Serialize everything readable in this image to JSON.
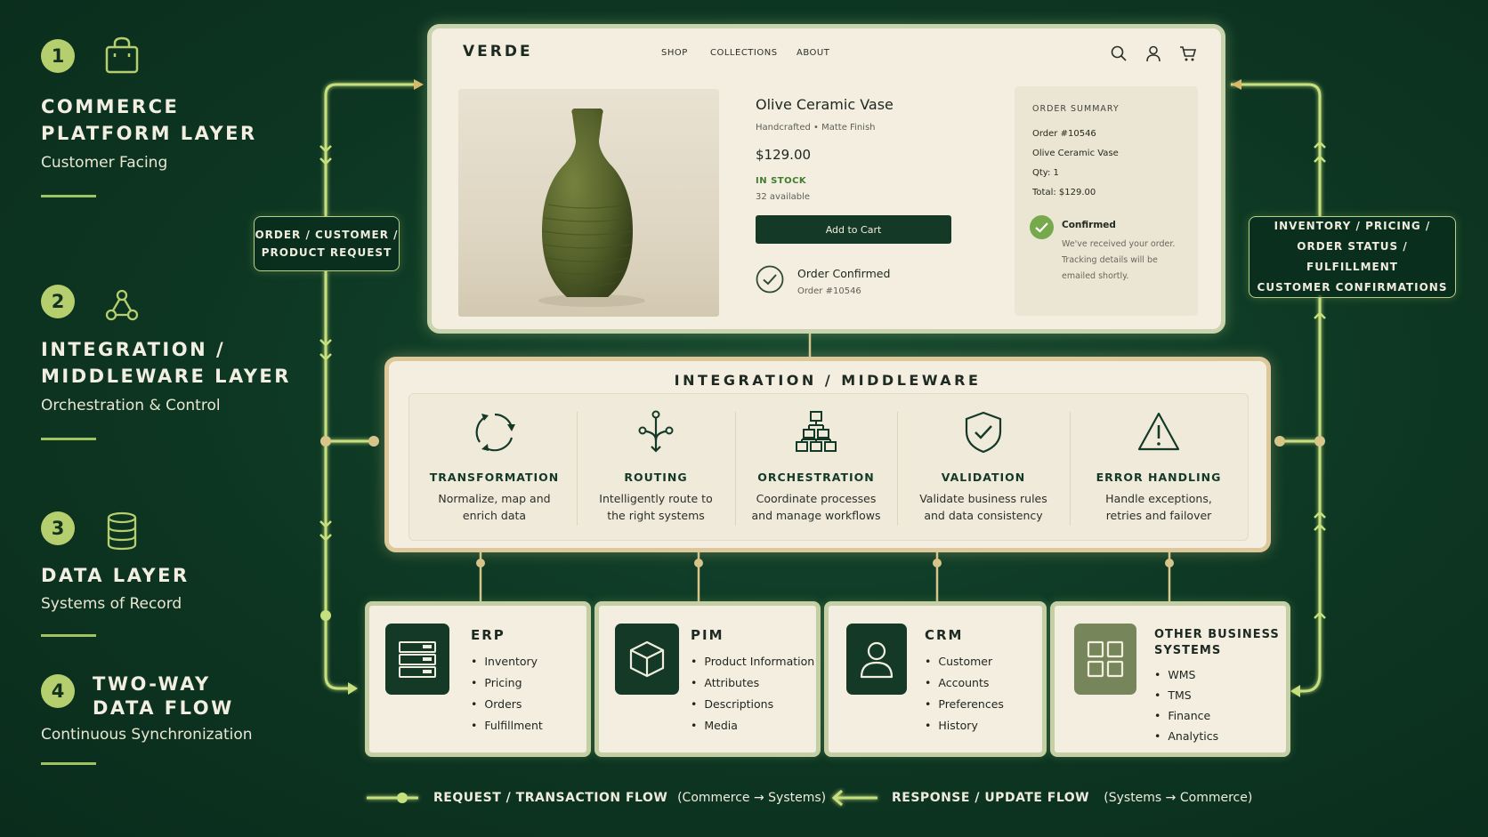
{
  "legend": [
    {
      "num": "1",
      "title_lines": [
        "COMMERCE",
        "PLATFORM LAYER"
      ],
      "subtitle": "Customer Facing",
      "icon": "shopping-bag-icon"
    },
    {
      "num": "2",
      "title_lines": [
        "INTEGRATION /",
        "MIDDLEWARE LAYER"
      ],
      "subtitle": "Orchestration & Control",
      "icon": "network-nodes-icon"
    },
    {
      "num": "3",
      "title_lines": [
        "DATA LAYER"
      ],
      "subtitle": "Systems of Record",
      "icon": "database-icon"
    },
    {
      "num": "4",
      "title_lines": [
        "TWO-WAY",
        "DATA FLOW"
      ],
      "subtitle": "Continuous Synchronization"
    }
  ],
  "callouts": {
    "left": [
      "ORDER / CUSTOMER /",
      "PRODUCT REQUEST"
    ],
    "right": [
      "INVENTORY / PRICING /",
      "ORDER STATUS / FULFILLMENT",
      "CUSTOMER CONFIRMATIONS"
    ]
  },
  "store": {
    "brand": "VERDE",
    "nav": [
      "SHOP",
      "COLLECTIONS",
      "ABOUT"
    ],
    "nav_icons": [
      "search-icon",
      "user-icon",
      "cart-icon"
    ],
    "product": {
      "title": "Olive Ceramic Vase",
      "meta": "Handcrafted  •  Matte Finish",
      "price": "$129.00",
      "stock": "IN STOCK",
      "available": "32 available",
      "cta": "Add to Cart",
      "confirm_title": "Order Confirmed",
      "confirm_order": "Order #10546"
    },
    "summary": {
      "heading": "ORDER SUMMARY",
      "lines": [
        "Order #10546",
        "Olive Ceramic Vase",
        "Qty: 1",
        "Total: $129.00"
      ],
      "status": "Confirmed",
      "note": [
        "We've received your order.",
        "Tracking details will be",
        "emailed shortly."
      ]
    }
  },
  "middleware": {
    "title": "INTEGRATION / MIDDLEWARE",
    "items": [
      {
        "title": "TRANSFORMATION",
        "desc": [
          "Normalize, map and",
          "enrich data"
        ],
        "icon": "transform-cycle-icon"
      },
      {
        "title": "ROUTING",
        "desc": [
          "Intelligently route to",
          "the right systems"
        ],
        "icon": "routing-fork-icon"
      },
      {
        "title": "ORCHESTRATION",
        "desc": [
          "Coordinate processes",
          "and manage workflows"
        ],
        "icon": "hierarchy-icon"
      },
      {
        "title": "VALIDATION",
        "desc": [
          "Validate business rules",
          "and data consistency"
        ],
        "icon": "shield-check-icon"
      },
      {
        "title": "ERROR HANDLING",
        "desc": [
          "Handle exceptions,",
          "retries and failover"
        ],
        "icon": "warning-triangle-icon"
      }
    ]
  },
  "systems": [
    {
      "title_lines": [
        "ERP"
      ],
      "items": [
        "Inventory",
        "Pricing",
        "Orders",
        "Fulfillment"
      ],
      "icon": "server-icon"
    },
    {
      "title_lines": [
        "PIM"
      ],
      "items": [
        "Product Information",
        "Attributes",
        "Descriptions",
        "Media"
      ],
      "icon": "box-icon"
    },
    {
      "title_lines": [
        "CRM"
      ],
      "items": [
        "Customer",
        "Accounts",
        "Preferences",
        "History"
      ],
      "icon": "person-icon"
    },
    {
      "title_lines": [
        "OTHER BUSINESS",
        "SYSTEMS"
      ],
      "items": [
        "WMS",
        "TMS",
        "Finance",
        "Analytics"
      ],
      "icon": "grid-icon"
    }
  ],
  "flow_legend": {
    "request": "REQUEST / TRANSACTION FLOW",
    "request_sub": "(Commerce → Systems)",
    "response": "RESPONSE / UPDATE FLOW",
    "response_sub": "(Systems → Commerce)"
  },
  "colors": {
    "background": "#0d3622",
    "accent": "#b5cf6e",
    "tile": "#143a27",
    "card": "#f3eedf",
    "stock": "#3f7d31"
  }
}
